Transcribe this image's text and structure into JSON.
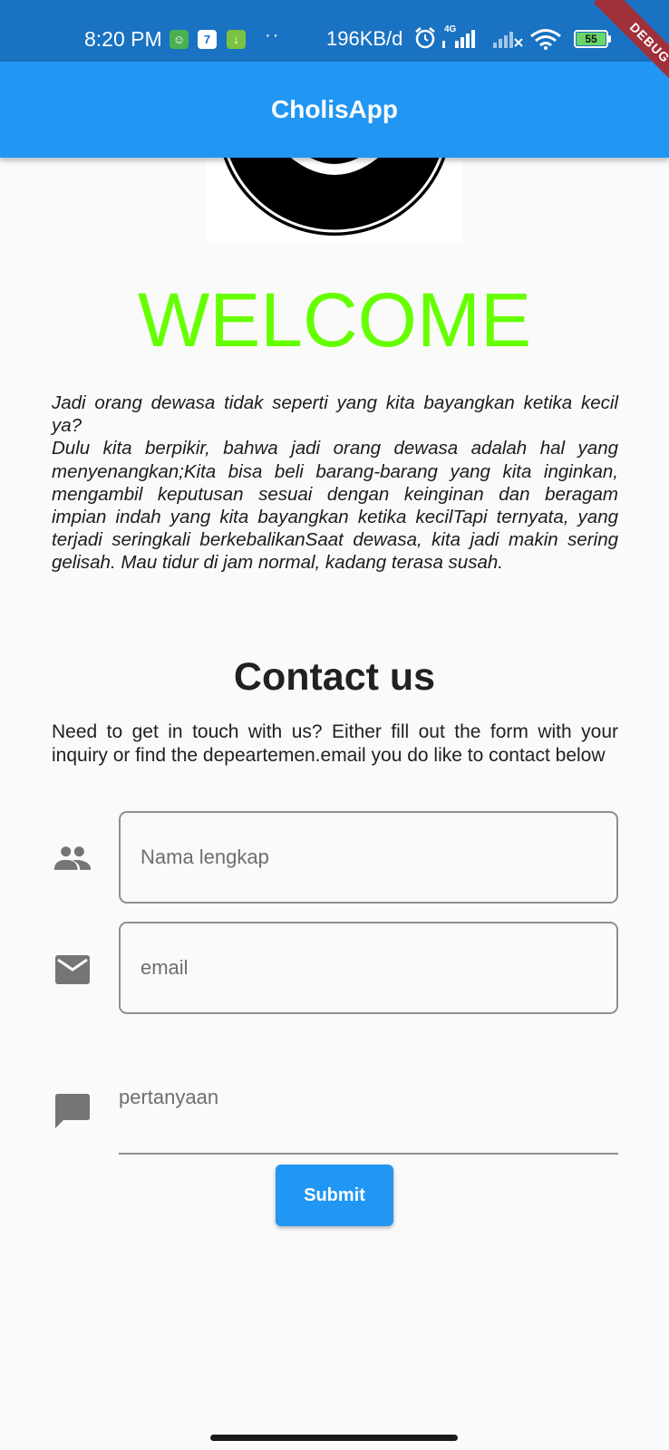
{
  "status_bar": {
    "time": "8:20 PM",
    "notification_icons": [
      "face-icon",
      "calendar-icon",
      "download-icon"
    ],
    "calendar_day": "7",
    "dots": "··",
    "network_speed": "196KB/d",
    "network_type": "4G",
    "battery_level": "55"
  },
  "debug_banner": "DEBUG",
  "app_bar": {
    "title": "CholisApp",
    "color": "#2196f3"
  },
  "welcome": {
    "text": "WELCOME",
    "color": "#66ff00"
  },
  "intro": {
    "line1": "Jadi orang dewasa tidak seperti yang kita bayangkan ketika kecil ya?",
    "line2": "Dulu kita berpikir, bahwa jadi orang dewasa adalah hal yang menyenangkan;Kita bisa beli barang-barang yang kita inginkan, mengambil keputusan sesuai dengan keinginan dan beragam impian indah yang kita bayangkan ketika kecilTapi ternyata, yang terjadi seringkali berkebalikanSaat dewasa, kita jadi makin sering gelisah. Mau tidur di jam normal, kadang terasa susah."
  },
  "contact": {
    "title": "Contact us",
    "description": "Need to get in touch with us? Either fill out the form with your inquiry or find the depeartemen.email you do like to contact below",
    "fields": {
      "name_placeholder": "Nama lengkap",
      "email_placeholder": "email",
      "question_placeholder": "pertanyaan"
    },
    "submit_label": "Submit"
  }
}
